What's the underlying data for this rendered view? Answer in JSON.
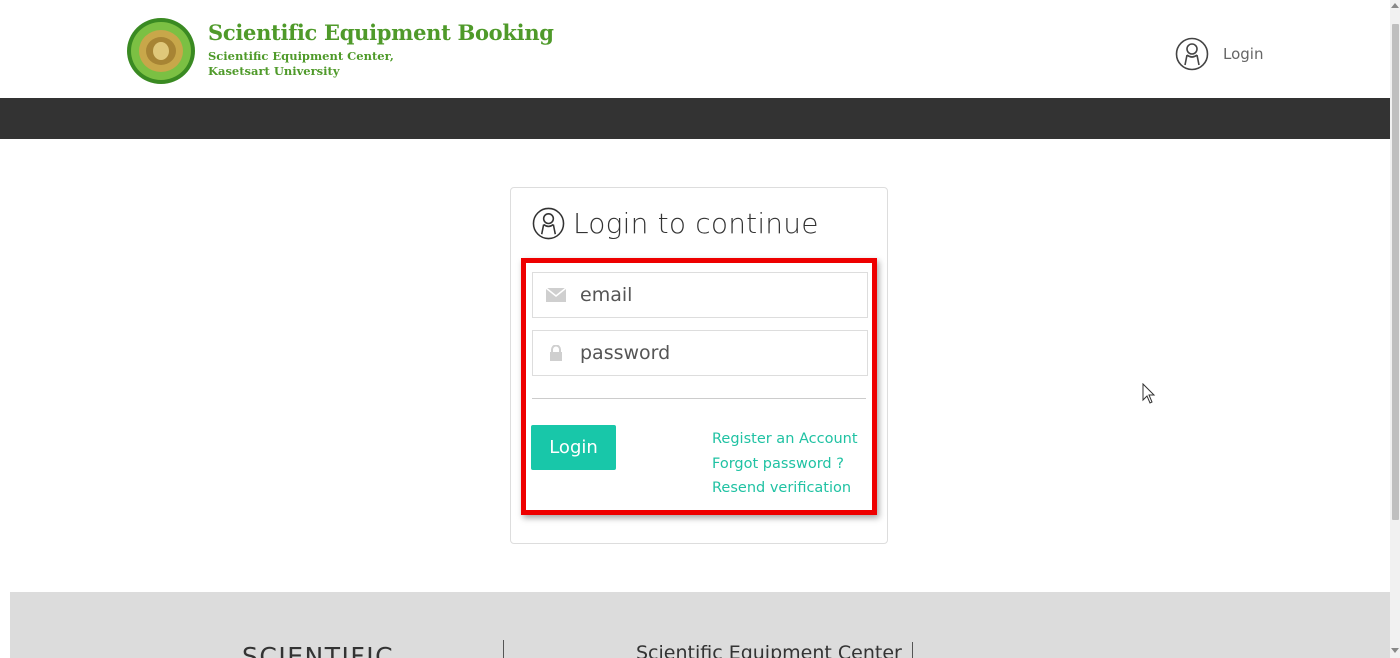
{
  "header": {
    "brand_title": "Scientific Equipment Booking",
    "brand_sub_1": "Scientific Equipment Center,",
    "brand_sub_2": "Kasetsart University",
    "login_label": "Login",
    "logo_icon": "university-seal-icon",
    "user_icon": "user-circle-icon",
    "brand_color": "#4f9a2a"
  },
  "login_card": {
    "title": "Login to continue",
    "title_icon": "user-circle-icon",
    "email_placeholder": "email",
    "email_icon": "envelope-icon",
    "password_placeholder": "password",
    "password_icon": "lock-icon",
    "login_button": "Login",
    "register_link": "Register an Account",
    "forgot_link": "Forgot password ?",
    "resend_link": "Resend verification",
    "accent_color": "#18c7a9",
    "highlight_color": "#ee0000"
  },
  "footer": {
    "left_text": "SCIENTIFIC",
    "center_text": "Scientific Equipment Center"
  },
  "navbar": {
    "color": "#333333"
  }
}
